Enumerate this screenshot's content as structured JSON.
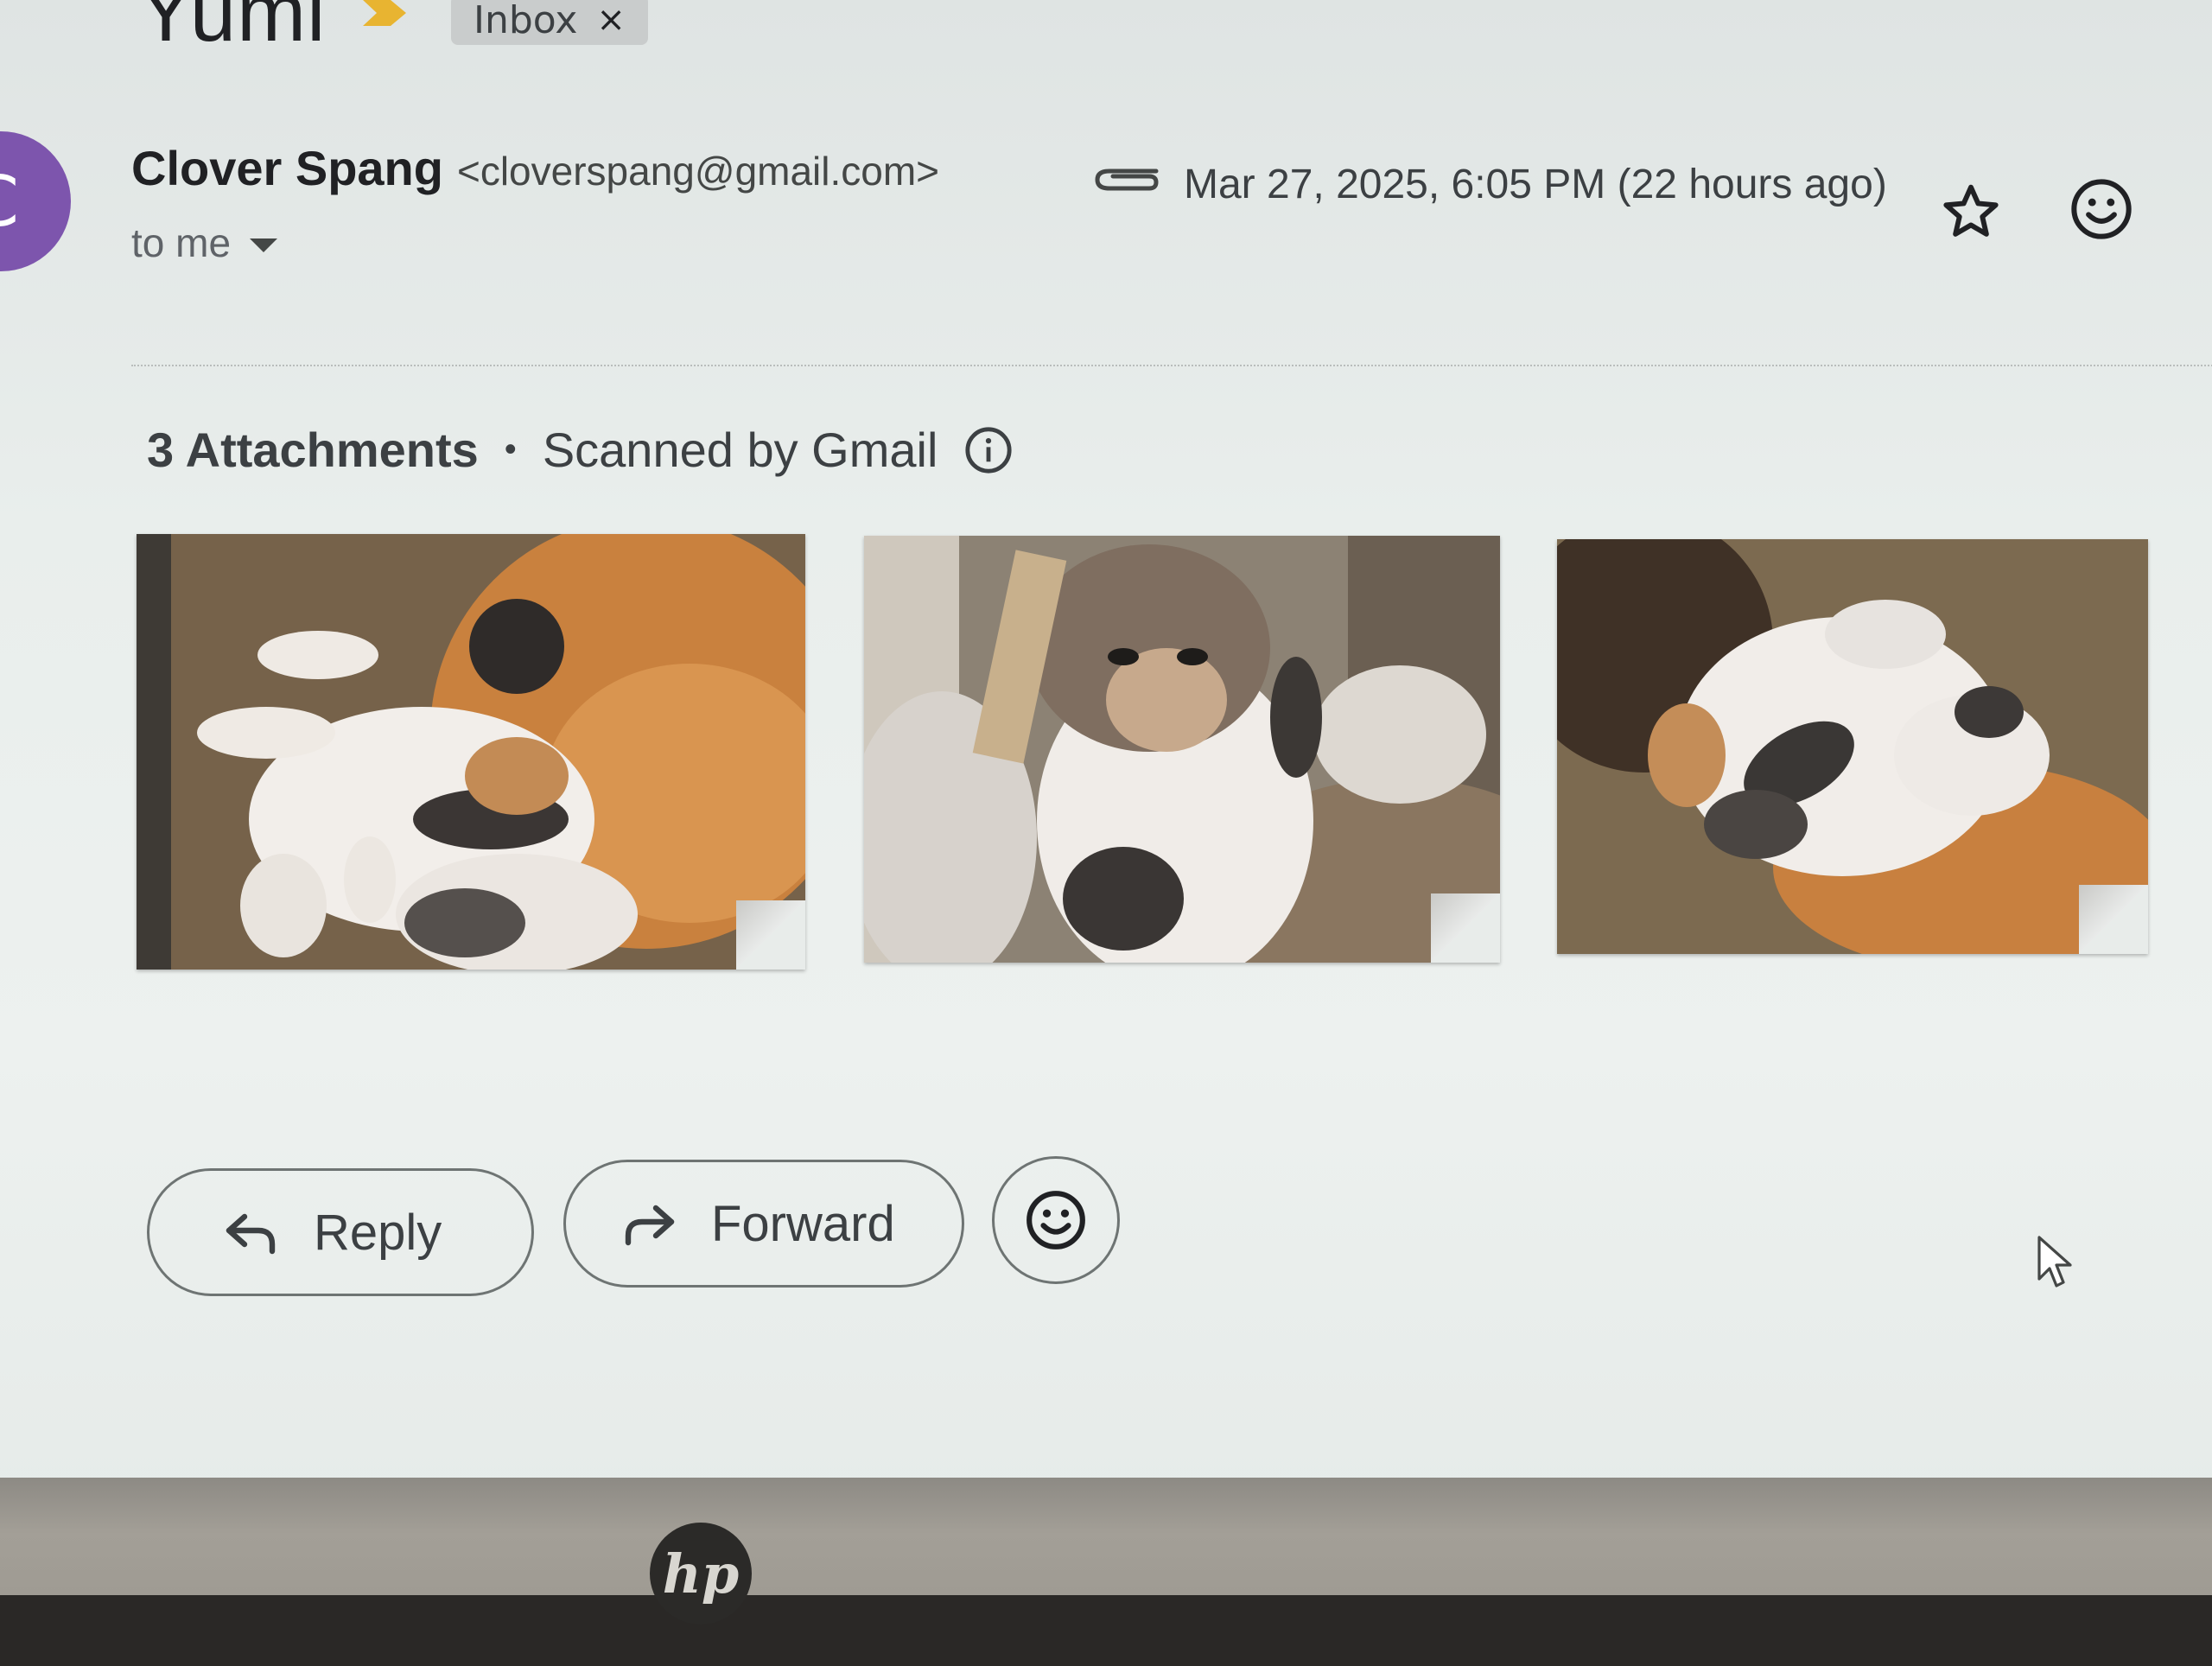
{
  "email": {
    "subject": "Yumi",
    "label": "Inbox",
    "label_close": "×",
    "sender_initial": "C",
    "sender_name": "Clover Spang",
    "sender_email": "<cloverspang@gmail.com>",
    "recipient": "to me",
    "timestamp": "Mar 27, 2025, 6:05 PM (22 hours ago)"
  },
  "attachments": {
    "count_label": "3 Attachments",
    "separator": "•",
    "scan_label": "Scanned by Gmail"
  },
  "actions": {
    "reply_label": "Reply",
    "forward_label": "Forward"
  },
  "device": {
    "logo": "hp"
  },
  "colors": {
    "avatar": "#7d55ad",
    "importance_marker": "#e8b431"
  },
  "icons": {
    "importance": "importance-marker-icon",
    "attachment": "paperclip-icon",
    "star": "star-icon",
    "emoji": "emoji-smile-icon",
    "info": "info-icon",
    "reply": "reply-arrow-icon",
    "forward": "forward-arrow-icon",
    "cursor": "mouse-pointer-icon"
  }
}
